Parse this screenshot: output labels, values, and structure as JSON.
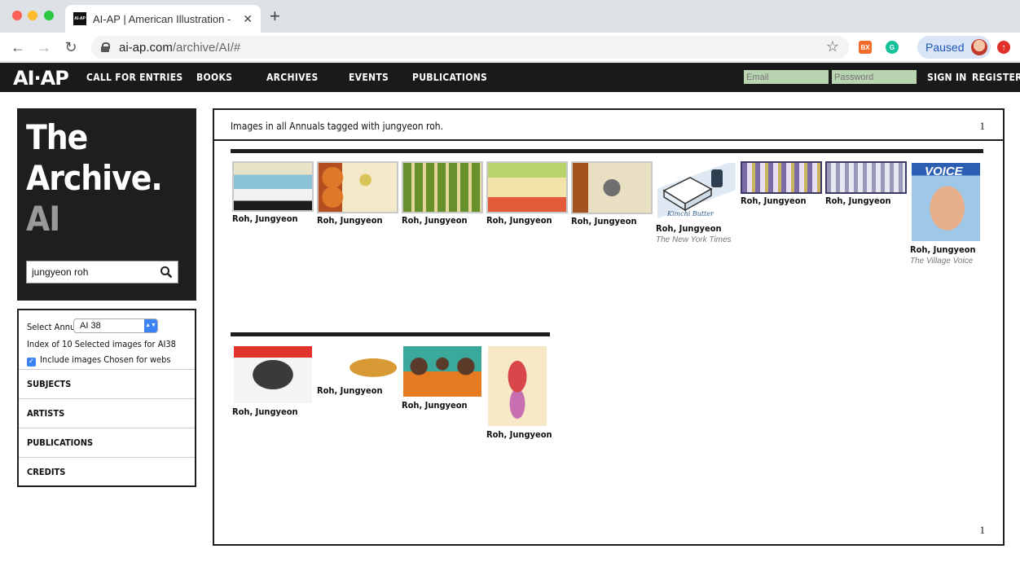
{
  "browser": {
    "tab_title": "AI-AP | American Illustration - ",
    "tab_favicon": "AI-AP",
    "url_host": "ai-ap.com",
    "url_path": "/archive/AI/#",
    "profile_label": "Paused",
    "ext_bx": "BX"
  },
  "site": {
    "logo": "AI·AP",
    "nav": [
      "CALL FOR ENTRIES",
      "BOOKS",
      "ARCHIVES",
      "EVENTS",
      "PUBLICATIONS"
    ],
    "email_placeholder": "Email",
    "password_placeholder": "Password",
    "sign_in": "SIGN IN",
    "register": "REGISTER"
  },
  "sidebar": {
    "title_line1": "The",
    "title_line2": "Archive.",
    "title_line3": "AI",
    "search_value": "jungyeon roh",
    "select_label": "Select Annual",
    "select_value": "AI 38",
    "index_text": "Index of 10 Selected images for AI38",
    "include_label": "Include images Chosen for webs",
    "menu": [
      "SUBJECTS",
      "ARTISTS",
      "PUBLICATIONS",
      "CREDITS"
    ]
  },
  "results": {
    "caption": "Images in all Annuals tagged with jungyeon roh.",
    "page_top": "1",
    "page_bottom": "1",
    "row1": [
      {
        "artist": "Roh, Jungyeon",
        "publication": ""
      },
      {
        "artist": "Roh, Jungyeon",
        "publication": ""
      },
      {
        "artist": "Roh, Jungyeon",
        "publication": ""
      },
      {
        "artist": "Roh, Jungyeon",
        "publication": ""
      },
      {
        "artist": "Roh, Jungyeon",
        "publication": ""
      },
      {
        "artist": "Roh, Jungyeon",
        "publication": "The New York Times"
      },
      {
        "artist": "Roh, Jungyeon",
        "publication": ""
      },
      {
        "artist": "Roh, Jungyeon",
        "publication": ""
      },
      {
        "artist": "Roh, Jungyeon",
        "publication": "The Village Voice"
      }
    ],
    "row2": [
      {
        "artist": "Roh, Jungyeon"
      },
      {
        "artist": "Roh, Jungyeon"
      },
      {
        "artist": "Roh, Jungyeon"
      },
      {
        "artist": "Roh, Jungyeon"
      }
    ],
    "butter_label": "Kimchi Butter",
    "voice_label": "VOICE"
  }
}
